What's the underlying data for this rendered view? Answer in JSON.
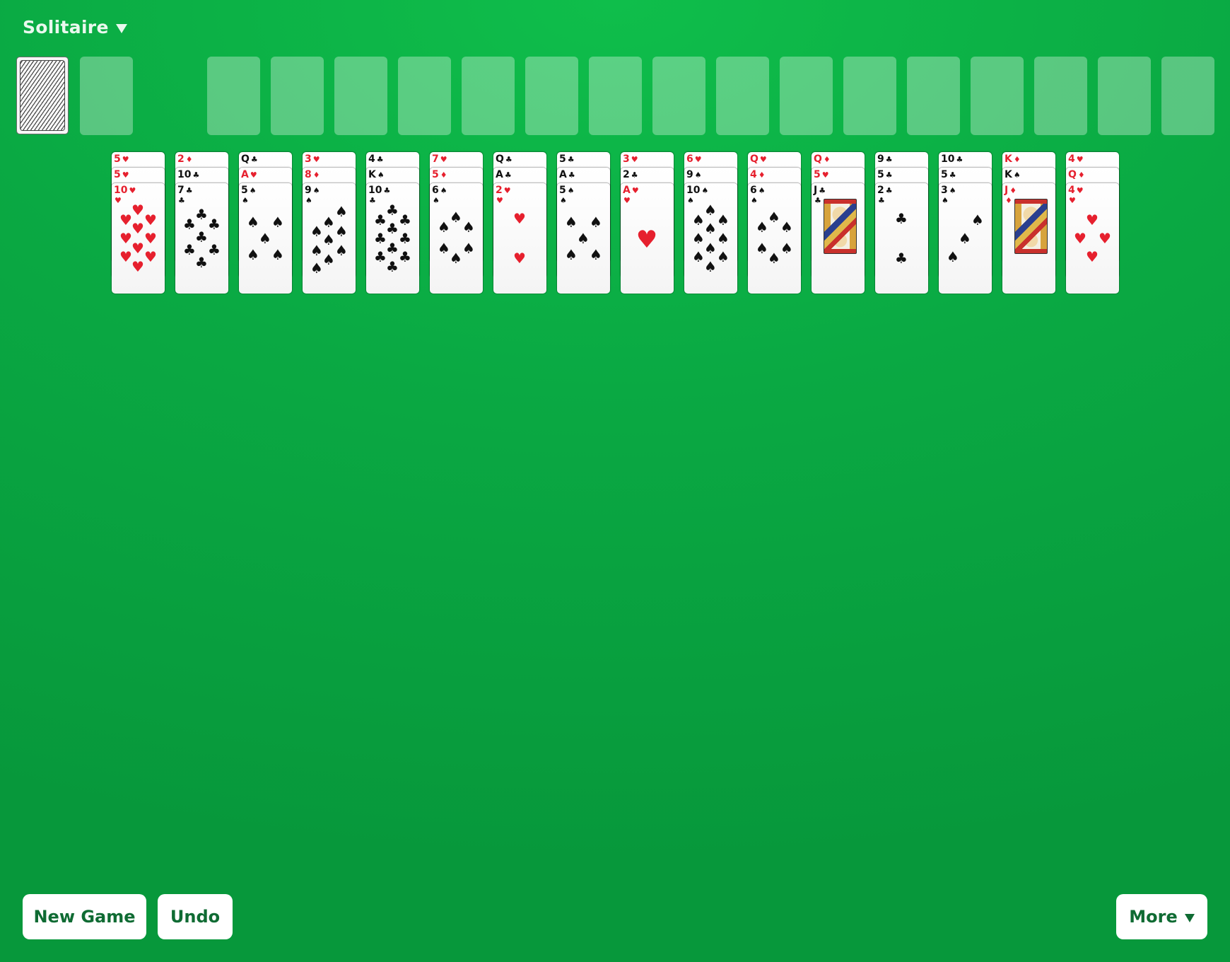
{
  "header": {
    "title": "Solitaire",
    "menu_icon": "triangle-down"
  },
  "stock": {
    "label": "stock-pile",
    "face": "down"
  },
  "waste": {
    "empty": true
  },
  "foundations": {
    "count": 16,
    "filled": 0
  },
  "tableau": [
    [
      "5♥",
      "5♥",
      "10♥"
    ],
    [
      "2♦",
      "10♣",
      "7♣"
    ],
    [
      "Q♣",
      "A♥",
      "5♠"
    ],
    [
      "3♥",
      "8♦",
      "9♠"
    ],
    [
      "4♣",
      "K♠",
      "10♣"
    ],
    [
      "7♥",
      "5♦",
      "6♠"
    ],
    [
      "Q♣",
      "A♣",
      "2♥"
    ],
    [
      "5♣",
      "A♣",
      "5♠"
    ],
    [
      "3♥",
      "2♣",
      "A♥"
    ],
    [
      "6♥",
      "9♠",
      "10♠"
    ],
    [
      "Q♥",
      "4♦",
      "6♠"
    ],
    [
      "Q♦",
      "5♥",
      "J♣"
    ],
    [
      "9♣",
      "5♣",
      "2♣"
    ],
    [
      "10♣",
      "5♣",
      "3♠"
    ],
    [
      "K♦",
      "K♠",
      "J♦"
    ],
    [
      "4♥",
      "Q♦",
      "4♥"
    ]
  ],
  "buttons": {
    "new_game": "New Game",
    "undo": "Undo",
    "more": "More"
  },
  "colors": {
    "table": "#0aa943",
    "red_suit": "#e6202e",
    "button_text": "#0f6b33"
  }
}
